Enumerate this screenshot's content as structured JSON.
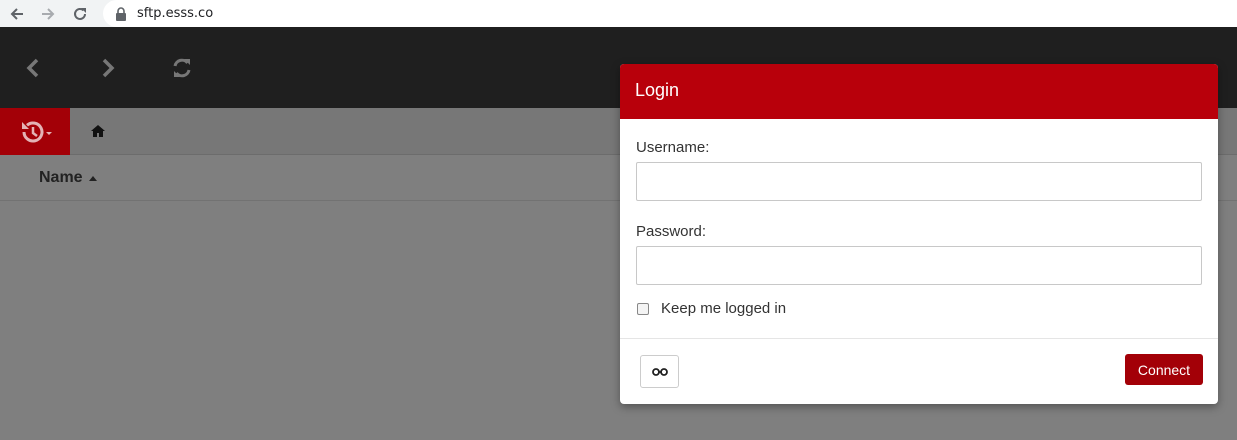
{
  "browser": {
    "url": "sftp.esss.co"
  },
  "list": {
    "column_name": "Name"
  },
  "login": {
    "title": "Login",
    "username_label": "Username:",
    "username_value": "",
    "password_label": "Password:",
    "password_value": "",
    "remember_label": "Keep me logged in",
    "remember_checked": false,
    "connect_label": "Connect"
  },
  "colors": {
    "brand_red": "#b8000b",
    "button_red": "#a30007",
    "header_dark": "#1f1f1f"
  }
}
